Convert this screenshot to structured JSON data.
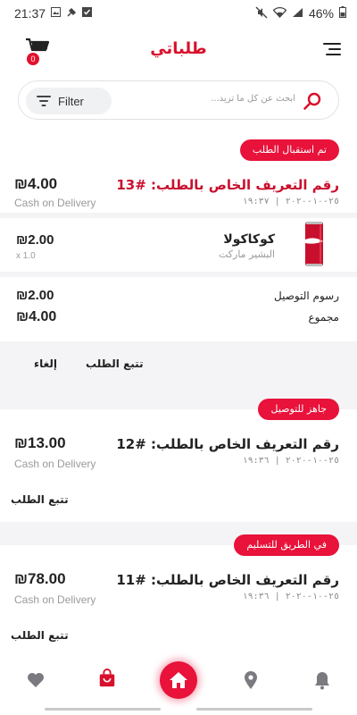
{
  "status_bar": {
    "time": "21:37",
    "battery": "46%"
  },
  "app": {
    "title": "طلباتي",
    "cart_count": "0"
  },
  "search": {
    "filter_label": "Filter",
    "placeholder": "ابحث عن كل ما تريد..."
  },
  "orders": [
    {
      "status": "تم استقبال الطلب",
      "title": "رقم التعريف الخاص بالطلب: #13",
      "date": "٢٥-١٠-٢٠٢٠ | ١٩:٣٧",
      "total": "₪4.00",
      "payment": "Cash on Delivery",
      "items": [
        {
          "name": "كوكاكولا",
          "store": "البشير ماركت",
          "price": "₪2.00",
          "qty": "x 1.0"
        }
      ],
      "delivery_label": "رسوم التوصيل",
      "delivery_fee": "₪2.00",
      "sum_label": "مجموع",
      "sum": "₪4.00",
      "actions": {
        "track": "تتبع الطلب",
        "cancel": "إلغاء"
      }
    },
    {
      "status": "جاهز للتوصيل",
      "title": "رقم التعريف الخاص بالطلب: #12",
      "date": "٢٥-١٠-٢٠٢٠ | ١٩:٣٦",
      "total": "₪13.00",
      "payment": "Cash on Delivery",
      "actions": {
        "track": "تتبع الطلب"
      }
    },
    {
      "status": "في الطريق للتسليم",
      "title": "رقم التعريف الخاص بالطلب: #11",
      "date": "٢٥-١٠-٢٠٢٠ | ١٩:٣٦",
      "total": "₪78.00",
      "payment": "Cash on Delivery",
      "actions": {
        "track": "تتبع الطلب"
      }
    }
  ],
  "nav": {
    "icons": [
      "heart-icon",
      "shopping-bag-icon",
      "home-icon",
      "location-pin-icon",
      "bell-icon"
    ]
  },
  "colors": {
    "accent": "#e8123a",
    "title_red": "#c8102e"
  }
}
